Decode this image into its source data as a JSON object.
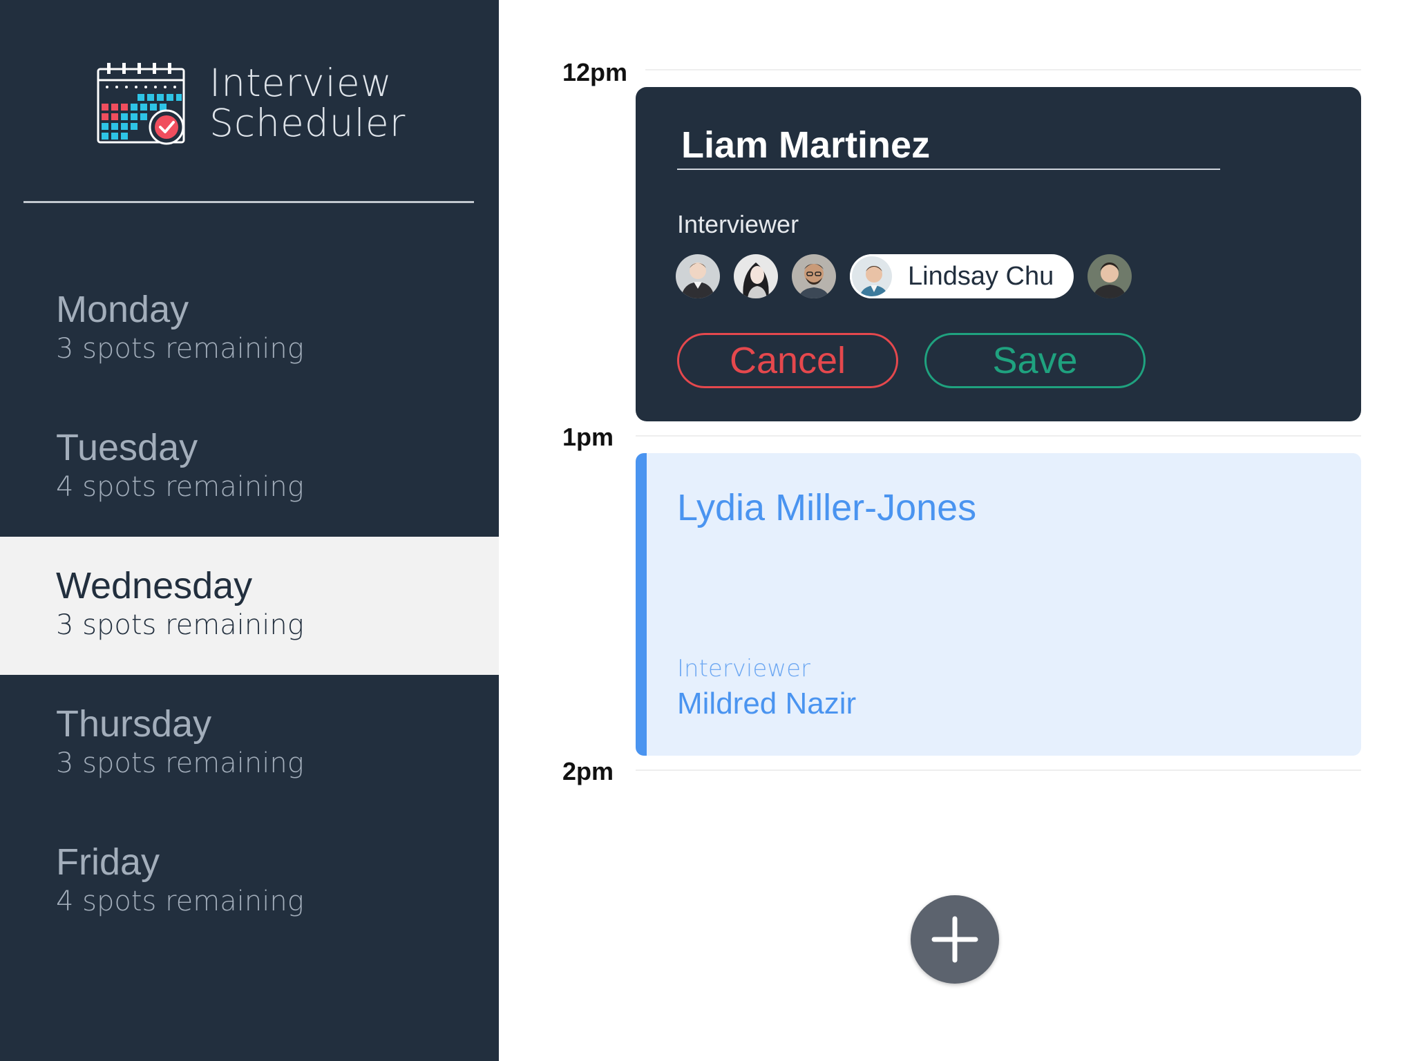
{
  "app": {
    "title_line1": "Interview",
    "title_line2": "Scheduler",
    "logo_icon": "calendar-check-icon"
  },
  "sidebar": {
    "days": [
      {
        "name": "Monday",
        "spots": "3 spots remaining",
        "selected": false
      },
      {
        "name": "Tuesday",
        "spots": "4 spots remaining",
        "selected": false
      },
      {
        "name": "Wednesday",
        "spots": "3 spots remaining",
        "selected": true
      },
      {
        "name": "Thursday",
        "spots": "3 spots remaining",
        "selected": false
      },
      {
        "name": "Friday",
        "spots": "4 spots remaining",
        "selected": false
      }
    ]
  },
  "schedule": {
    "times": [
      "12pm",
      "1pm",
      "2pm"
    ],
    "editor": {
      "student_name": "Liam Martinez",
      "interviewer_label": "Interviewer",
      "selected_interviewer": "Lindsay Chu",
      "cancel_label": "Cancel",
      "save_label": "Save"
    },
    "appointment": {
      "student_name": "Lydia Miller-Jones",
      "interviewer_label": "Interviewer",
      "interviewer_name": "Mildred Nazir"
    },
    "add_icon": "plus-icon"
  },
  "colors": {
    "sidebar_bg": "#222f3e",
    "selected_day_bg": "#f2f2f2",
    "cancel": "#e5484d",
    "save": "#1fa27f",
    "appointment_accent": "#4a94f0",
    "appointment_bg": "#e6f0fd",
    "add_button": "#5c636e"
  }
}
